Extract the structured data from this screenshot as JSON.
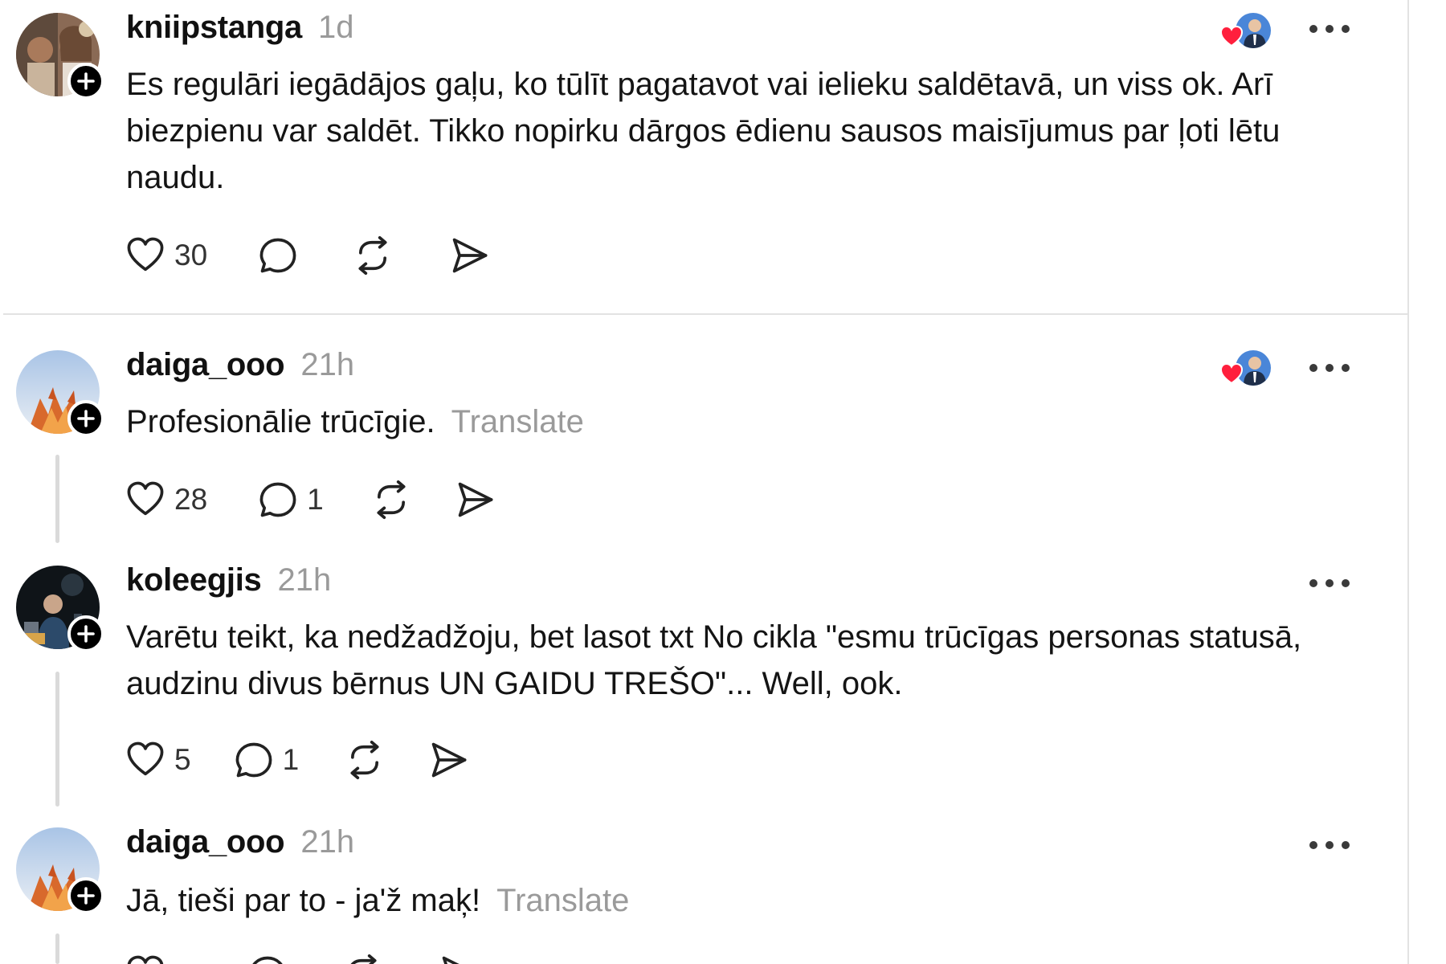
{
  "posts": [
    {
      "username": "kniipstanga",
      "time": "1d",
      "text": "Es regulāri iegādājos gaļu, ko tūlīt pagatavot vai ielieku saldētavā, un viss ok. Arī biezpienu var saldēt. Tikko nopirku dārgos ēdienu sausos maisījumus par ļoti lētu naudu.",
      "translate": "",
      "likes": "30",
      "replies": "",
      "liked_by_shown": true
    },
    {
      "username": "daiga_ooo",
      "time": "21h",
      "text": "Profesionālie trūcīgie.",
      "translate": "Translate",
      "likes": "28",
      "replies": "1",
      "liked_by_shown": true
    },
    {
      "username": "koleegjis",
      "time": "21h",
      "text": "Varētu teikt, ka nedžadžoju, bet lasot txt No cikla \"esmu trūcīgas personas statusā, audzinu divus bērnus UN GAIDU TREŠO\"... Well, ook.",
      "translate": "",
      "likes": "5",
      "replies": "1",
      "liked_by_shown": false
    },
    {
      "username": "daiga_ooo",
      "time": "21h",
      "text": "Jā, tieši par to - ja'ž maķ!",
      "translate": "Translate",
      "likes": "",
      "replies": "",
      "liked_by_shown": false
    }
  ],
  "icons": {
    "like": "heart-outline-icon",
    "reply": "speech-bubble-icon",
    "repost": "repost-arrows-icon",
    "share": "paper-plane-icon",
    "more": "more-horizontal-icon",
    "follow": "plus-circle-icon",
    "liked_by_heart": "heart-filled-icon"
  },
  "colors": {
    "text": "#141414",
    "muted": "#9a9a9a",
    "heart": "#ff1f3d",
    "divider": "#e2e2e2"
  }
}
